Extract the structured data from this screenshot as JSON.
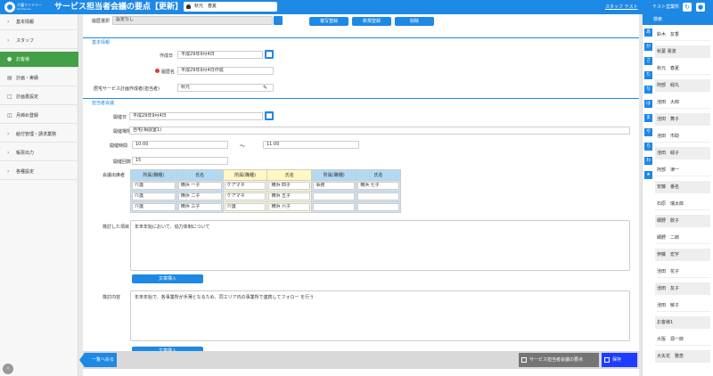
{
  "header": {
    "brand": "介護ファミリー",
    "brand_sub": "familycare",
    "title": "サービス担当者会議の要点【更新】",
    "user": "秋元　春夏",
    "staff_link": "スタッフ テスト",
    "office": "テスト営業所"
  },
  "sidebar": {
    "items": [
      {
        "label": "基本情報"
      },
      {
        "label": "スタッフ"
      },
      {
        "label": "お客様"
      },
      {
        "label": "計画・実績"
      },
      {
        "label": "計画書設定"
      },
      {
        "label": "月締め登録"
      },
      {
        "label": "給付管理・請求業務"
      },
      {
        "label": "帳票出力"
      },
      {
        "label": "各種設定"
      }
    ]
  },
  "main": {
    "history_label": "履歴選択",
    "history_value": "設定なし",
    "buttons": {
      "copy": "複写登録",
      "new": "新規登録",
      "delete": "削除"
    },
    "basic": {
      "section": "基本情報",
      "created_label": "作成日",
      "created_value": "平成29年9月4日",
      "history_name_label": "履歴名",
      "history_name_value": "平成29年9月4日作成",
      "author_label": "居宅サービス計画作成者(担当者)",
      "author_value": "秋元"
    },
    "meeting": {
      "section": "担当者会議",
      "date_label": "開催日",
      "date_value": "平成29年9月4日",
      "place_label": "開催場所",
      "place_value": "自宅(相談室1)",
      "time_label": "開催時間",
      "time_start": "10:00",
      "time_sep": "〜",
      "time_end": "11:00",
      "count_label": "開催回数",
      "count_value": "15",
      "attendees_label": "会議出席者",
      "col_headers": [
        "所属(職種)",
        "氏名",
        "所属(職種)",
        "氏名",
        "所属(職種)",
        "氏名"
      ],
      "rows": [
        [
          "介護",
          "横浜 一子",
          "ケアマネ",
          "横浜 四子",
          "事務",
          "横浜 七子"
        ],
        [
          "介護",
          "横浜 二子",
          "ケアマネ",
          "横浜 五子",
          "",
          ""
        ],
        [
          "介護",
          "横浜 三子",
          "介護",
          "横浜 六子",
          "",
          ""
        ]
      ],
      "topics_label": "検討した項目",
      "topics_value": "年末年始において、協力体制について",
      "sentence_btn": "文章挿入",
      "content_label": "検討内容",
      "content_value": "年末年始で、各事業所が手薄となるため、同エリア内の事業所で連携してフォロー  を行う",
      "sentence_btn2": "文章挿入"
    }
  },
  "footer": {
    "back": "一覧へ戻る",
    "outline": "サービス担当者会議の要点",
    "save": "保存"
  },
  "right_panel": {
    "title": "検索",
    "kana": [
      "あ",
      "か",
      "さ",
      "た",
      "な",
      "は",
      "ま",
      "や",
      "ら",
      "わ",
      "★"
    ],
    "names": [
      "鈴木　友香",
      "秋葉 電波",
      "秋元　春夏",
      "阿部　緑丸",
      "池田　大郎",
      "池田　舞子",
      "池田　市助",
      "池田　緑子",
      "阿部　津一",
      "安藤　番名",
      "石原　瑞太郎",
      "細野　飲子",
      "細野　二郎",
      "伊藤　宏宇",
      "池田　花子",
      "池田　友子",
      "池田　敏子",
      "お客様1",
      "大阪　源一郎",
      "大矢花　雅恵"
    ]
  }
}
